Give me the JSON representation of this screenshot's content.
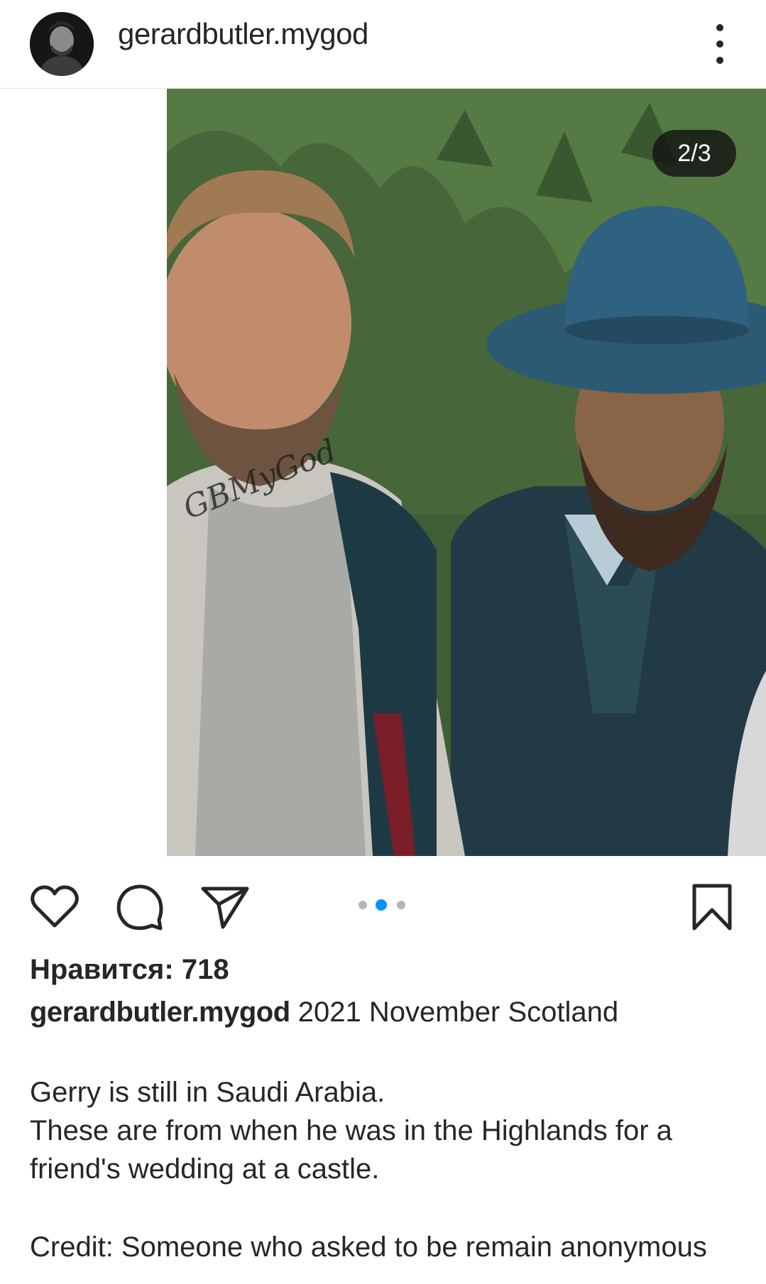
{
  "header": {
    "username": "gerardbutler.mygod"
  },
  "media": {
    "counter": "2/3",
    "current_index": 2,
    "total": 3,
    "watermark": "GBMyGod"
  },
  "post": {
    "likes": "Нравится: 718",
    "caption_user": "gerardbutler.mygod",
    "caption_title": "2021 November Scotland",
    "caption_body": "Gerry is still in Saudi Arabia.\nThese are from when he was in the Highlands for a\nfriend's wedding at a castle.",
    "credit": "Credit: Someone who asked to be remain anonymous"
  },
  "colors": {
    "accent": "#0095f6",
    "text": "#262626"
  },
  "icons": [
    "heart-icon",
    "comment-icon",
    "share-icon",
    "bookmark-icon",
    "more-vertical-icon"
  ]
}
